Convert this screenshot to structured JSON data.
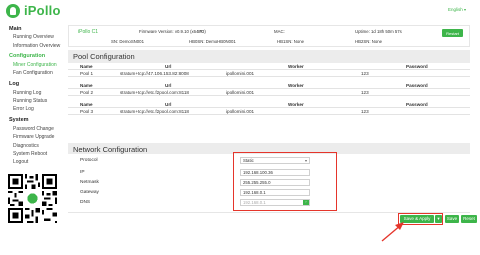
{
  "app": {
    "brand": "iPollo",
    "language": "English"
  },
  "sidebar": {
    "groups": [
      {
        "label": "Main",
        "items": [
          {
            "label": "Running Overview"
          },
          {
            "label": "Information Overview"
          }
        ]
      },
      {
        "label": "Configuration",
        "items": [
          {
            "label": "Miner Configuration",
            "active": true
          },
          {
            "label": "Fan Configuration"
          }
        ]
      },
      {
        "label": "Log",
        "items": [
          {
            "label": "Running Log"
          },
          {
            "label": "Running Status"
          },
          {
            "label": "Error Log"
          }
        ]
      },
      {
        "label": "System",
        "items": [
          {
            "label": "Password Change"
          },
          {
            "label": "Firmware Upgrade"
          },
          {
            "label": "Diagnostics"
          },
          {
            "label": "System Reboot"
          },
          {
            "label": "Logout"
          }
        ]
      }
    ]
  },
  "device": {
    "name": "iPollo C1",
    "firmware": "Firmware Version: v0.9.10 (x64 n3)",
    "ip_label": "IP:",
    "mac_label": "MAC:",
    "uptime": "Uptime: 1d 18h 50m 57s",
    "sn": "SN: DemoSN001",
    "hb0sn": "HB0SN: DemoHB0N001",
    "hb1sn": "HB1SN: None",
    "hb2sn": "HB2SN: None",
    "restart_label": "Restart"
  },
  "pool_config": {
    "title": "Pool Configuration",
    "columns": [
      "Name",
      "Url",
      "Worker",
      "Password"
    ],
    "pools": [
      {
        "name": "Pool 1",
        "url": "stratum+tcp://47.106.153.82:8008",
        "worker": "ipollomini.001",
        "password": "123"
      },
      {
        "name": "Pool 2",
        "url": "stratum+tcp://etc.f2pool.com:8118",
        "worker": "ipollomini.001",
        "password": "123"
      },
      {
        "name": "Pool 3",
        "url": "stratum+tcp://etc.f2pool.com:8118",
        "worker": "ipollomini.001",
        "password": "123"
      }
    ]
  },
  "network_config": {
    "title": "Network Configuration",
    "protocol_label": "Protocol",
    "protocol_value": "Static",
    "ip_label": "IP",
    "ip_value": "192.168.100.36",
    "netmask_label": "Netmask",
    "netmask_value": "255.255.255.0",
    "gateway_label": "Gateway",
    "gateway_value": "192.168.0.1",
    "dns_label": "DNS",
    "dns_placeholder": "192.168.0.1"
  },
  "actions": {
    "save_apply": "Save & Apply",
    "save": "Save",
    "reset": "Reset"
  },
  "colors": {
    "accent": "#3db54a",
    "highlight": "#e5352b"
  },
  "icons": [
    "ipollo-logo-icon",
    "language-chevron-icon",
    "select-chevron-icon",
    "dns-add-icon",
    "dropdown-caret-icon",
    "qr-code-icon",
    "red-arrow-icon"
  ]
}
